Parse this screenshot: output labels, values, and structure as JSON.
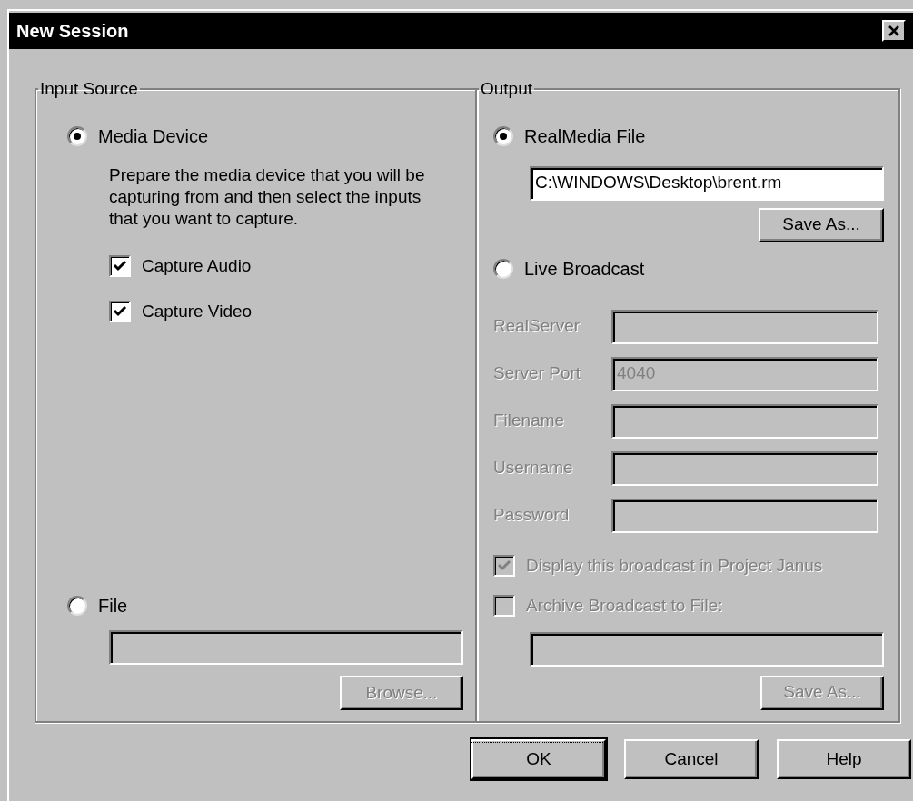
{
  "window": {
    "title": "New Session"
  },
  "input_source": {
    "title": "Input Source",
    "options": [
      {
        "label": "Media Device",
        "selected": true
      },
      {
        "label": "File",
        "selected": false
      }
    ],
    "description": "Prepare the media device that you will be capturing from and then select the inputs that you want to capture.",
    "checkboxes": [
      {
        "label": "Capture Audio",
        "checked": true,
        "disabled": false
      },
      {
        "label": "Capture Video",
        "checked": true,
        "disabled": false
      }
    ],
    "file_field": {
      "disabled": true
    },
    "browse_button": {
      "label": "Browse...",
      "disabled": true
    }
  },
  "output": {
    "title": "Output",
    "options": [
      {
        "label": "RealMedia File",
        "selected": true
      },
      {
        "label": "Live Broadcast",
        "selected": false
      }
    ],
    "file_path": {
      "value": "C:\\WINDOWS\\Desktop\\brent.rm",
      "disabled": false
    },
    "save_button": {
      "label": "Save As...",
      "disabled": false
    },
    "broadcast_fields": [
      {
        "label": "RealServer",
        "disabled": true
      },
      {
        "label": "Server Port",
        "value": "4040",
        "disabled": true
      },
      {
        "label": "Filename",
        "disabled": true
      },
      {
        "label": "Username",
        "disabled": true
      },
      {
        "label": "Password",
        "disabled": true
      }
    ],
    "broadcast_checkboxes": [
      {
        "label": "Display this broadcast in Project Janus",
        "checked": true,
        "disabled": true
      },
      {
        "label": "Archive Broadcast to File:",
        "checked": false,
        "disabled": true
      }
    ],
    "archive_field": {
      "disabled": true
    },
    "archive_save_button": {
      "label": "Save As...",
      "disabled": true
    }
  },
  "buttons": [
    {
      "label": "OK",
      "default": true
    },
    {
      "label": "Cancel",
      "default": false
    },
    {
      "label": "Help",
      "default": false
    }
  ]
}
